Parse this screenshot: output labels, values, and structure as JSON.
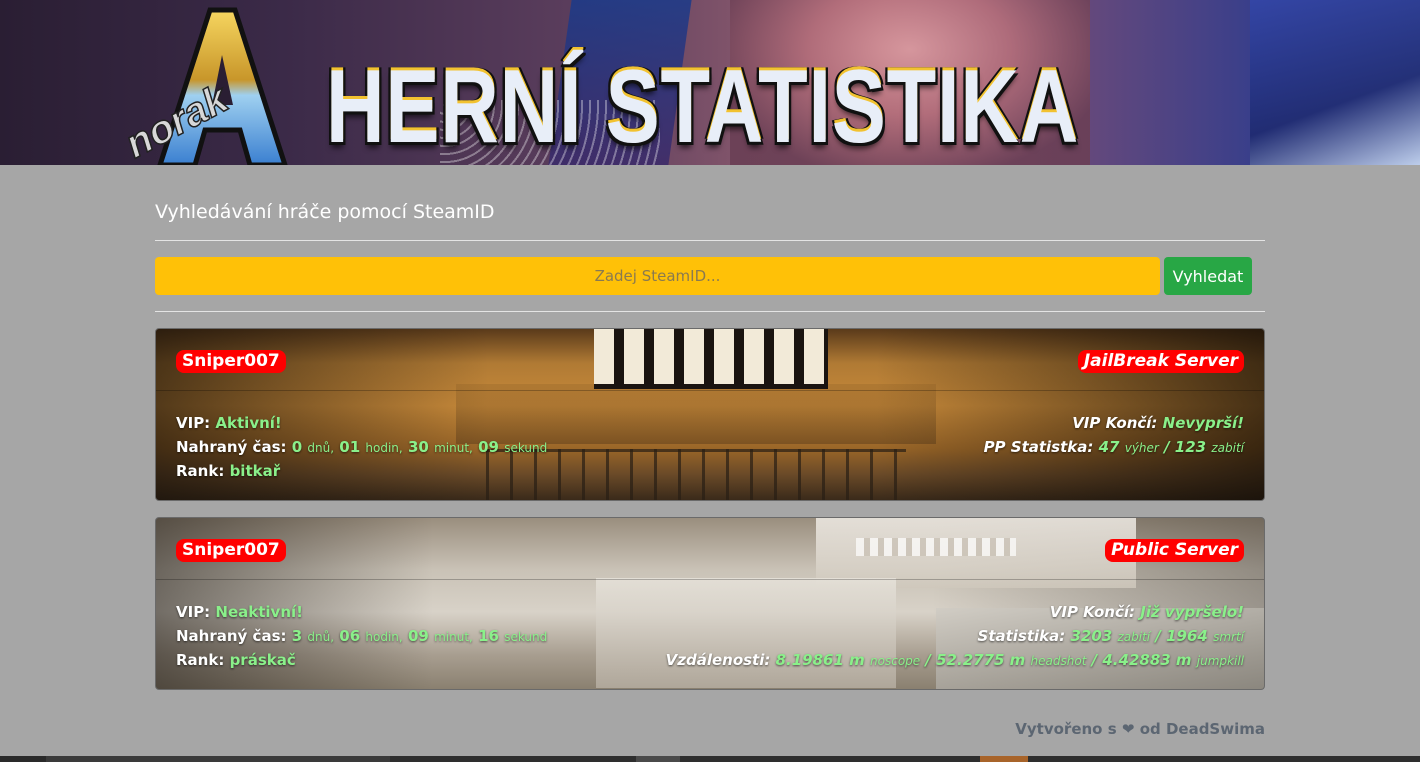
{
  "banner": {
    "logo_text": "Anorak",
    "title": "HERNÍ STATISTIKA"
  },
  "search": {
    "title": "Vyhledávání hráče pomocí SteamID",
    "placeholder": "Zadej SteamID...",
    "button_label": "Vyhledat"
  },
  "colors": {
    "input_bg": "#ffc107",
    "button_bg": "#28a745",
    "badge_bg": "#ff0000",
    "value_green": "#8af08a",
    "page_bg": "#a6a6a6"
  },
  "cards": [
    {
      "player": "Sniper007",
      "server": "JailBreak Server",
      "vip_label": "VIP:",
      "vip_value": "Aktivní!",
      "time_label": "Nahraný čas:",
      "time_days": "0",
      "time_days_unit": "dnů,",
      "time_hours": "01",
      "time_hours_unit": "hodin,",
      "time_minutes": "30",
      "time_minutes_unit": "minut,",
      "time_seconds": "09",
      "time_seconds_unit": "sekund",
      "rank_label": "Rank:",
      "rank_value": "bitkař",
      "vip_end_label": "VIP Končí:",
      "vip_end_value": "Nevyprší!",
      "stat_label": "PP Statistka:",
      "stat_a": "47",
      "stat_a_unit": "výher",
      "stat_sep": "/",
      "stat_b": "123",
      "stat_b_unit": "zabití"
    },
    {
      "player": "Sniper007",
      "server": "Public Server",
      "vip_label": "VIP:",
      "vip_value": "Neaktivní!",
      "time_label": "Nahraný čas:",
      "time_days": "3",
      "time_days_unit": "dnů,",
      "time_hours": "06",
      "time_hours_unit": "hodin,",
      "time_minutes": "09",
      "time_minutes_unit": "minut,",
      "time_seconds": "16",
      "time_seconds_unit": "sekund",
      "rank_label": "Rank:",
      "rank_value": "práskač",
      "vip_end_label": "VIP Končí:",
      "vip_end_value": "Již vypršelo!",
      "stat_label": "Statistika:",
      "stat_a": "3203",
      "stat_a_unit": "zabití",
      "stat_sep": "/",
      "stat_b": "1964",
      "stat_b_unit": "smrtí",
      "dist_label": "Vzdálenosti:",
      "dist_a": "8.19861 m",
      "dist_a_unit": "noscope",
      "dist_b": "52.2775 m",
      "dist_b_unit": "headshot",
      "dist_c": "4.42883 m",
      "dist_c_unit": "jumpkill"
    }
  ],
  "footer": {
    "prefix": "Vytvořeno s",
    "heart_icon": "heart-icon",
    "suffix": "od DeadSwima"
  }
}
